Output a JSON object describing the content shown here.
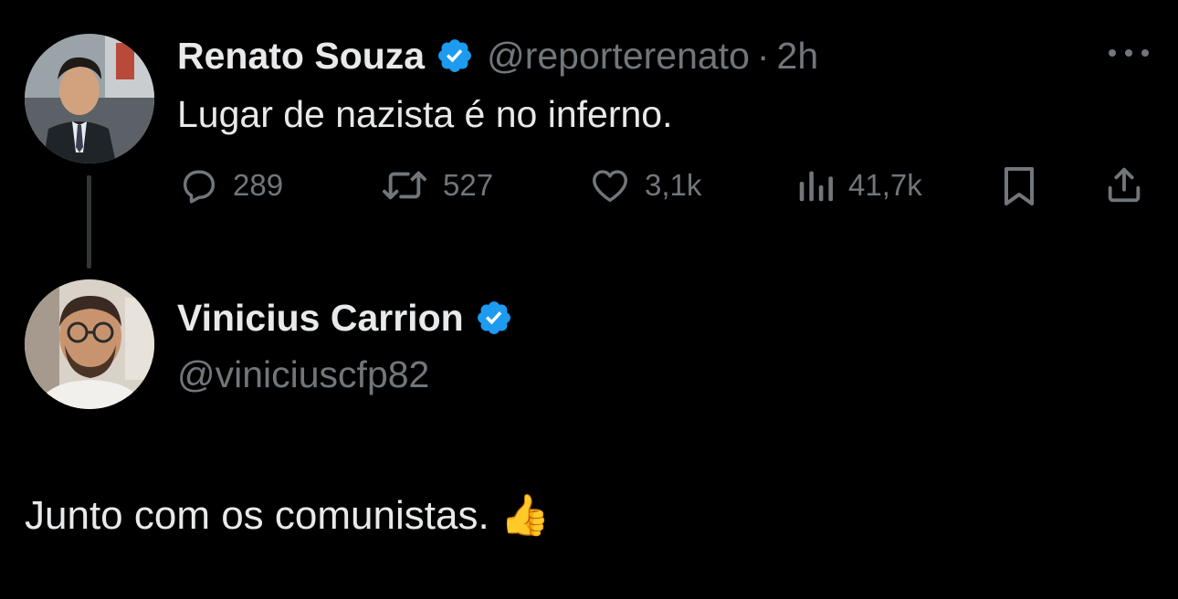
{
  "tweet": {
    "author_name": "Renato Souza",
    "author_handle": "@reporterenato",
    "separator": "·",
    "time": "2h",
    "text": "Lugar de nazista é no inferno.",
    "metrics": {
      "replies": "289",
      "reposts": "527",
      "likes": "3,1k",
      "views": "41,7k"
    }
  },
  "reply": {
    "author_name": "Vinicius Carrion",
    "author_handle": "@viniciuscfp82",
    "text": "Junto com os comunistas. 👍"
  },
  "colors": {
    "background": "#000000",
    "primary_text": "#e7e9ea",
    "secondary_text": "#71767b",
    "verified_blue": "#1d9bf0",
    "thread_line": "#333639"
  },
  "icons": [
    "reply-icon",
    "repost-icon",
    "like-icon",
    "views-icon",
    "bookmark-icon",
    "share-icon",
    "verified-badge-icon",
    "more-icon"
  ]
}
